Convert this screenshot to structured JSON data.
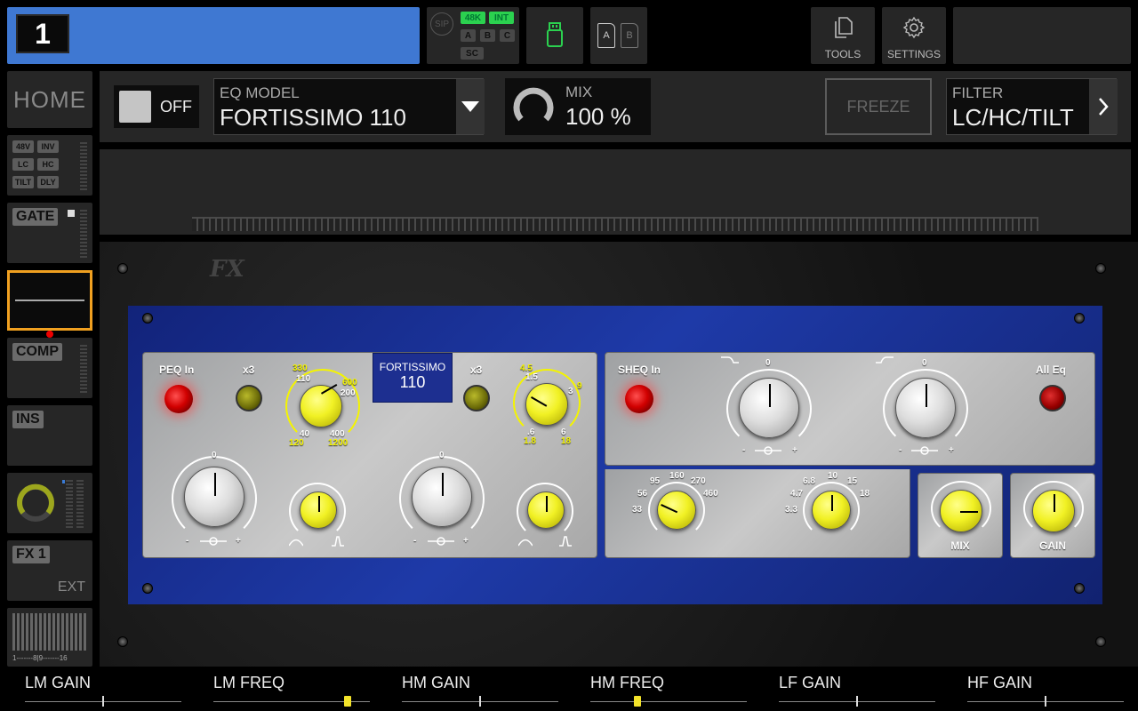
{
  "channel": {
    "number": "1"
  },
  "io": {
    "sip_label": "SIP",
    "rate": "48K",
    "clock": "INT",
    "inputs": [
      "A",
      "B",
      "C"
    ],
    "sc": "SC",
    "accent_on": "#2bd14f"
  },
  "snapshot_cards": [
    "A",
    "B"
  ],
  "toolbar": {
    "tools_label": "TOOLS",
    "settings_label": "SETTINGS"
  },
  "sidebar": {
    "home_label": "HOME",
    "input_tags": [
      "48V",
      "INV",
      "LC",
      "HC",
      "TILT",
      "DLY"
    ],
    "gate_label": "GATE",
    "comp_label": "COMP",
    "ins_label": "INS",
    "fx_label": "FX 1",
    "fx_ext": "EXT",
    "meter_scale": "1-------8|9-------16",
    "selected_color": "#f0a020"
  },
  "header": {
    "power_label": "OFF",
    "eq_model_label": "EQ MODEL",
    "eq_model_value": "FORTISSIMO 110",
    "mix_label": "MIX",
    "mix_value": "100 %",
    "freeze_label": "FREEZE",
    "filter_label": "FILTER",
    "filter_value": "LC/HC/TILT"
  },
  "plugin": {
    "brand_logo": "FX",
    "peq_in": "PEQ In",
    "x3_left": "x3",
    "x3_right": "x3",
    "name_line1": "FORTISSIMO",
    "name_line2": "110",
    "lm_freq_scale": [
      "330",
      "110",
      "600",
      "200",
      "40",
      "400",
      "120",
      "1200"
    ],
    "hm_freq_scale": [
      "4.5",
      "1.5",
      "3",
      "9",
      ".6",
      "6",
      "1.8",
      "18"
    ],
    "zero": "0",
    "minus": "-",
    "plus": "+",
    "sheq_in": "SHEQ In",
    "all_eq": "All Eq",
    "lf_freq_scale": [
      "95",
      "160",
      "270",
      "56",
      "460",
      "33"
    ],
    "hf_freq_scale": [
      "6.8",
      "10",
      "15",
      "4.7",
      "18",
      "3.3"
    ],
    "mix_knob_label": "MIX",
    "gain_knob_label": "GAIN"
  },
  "bottom_params": [
    {
      "label": "LM GAIN",
      "value": 0.5,
      "thumb": false
    },
    {
      "label": "LM FREQ",
      "value": 0.86,
      "thumb": true
    },
    {
      "label": "HM GAIN",
      "value": 0.5,
      "thumb": false
    },
    {
      "label": "HM FREQ",
      "value": 0.3,
      "thumb": true
    },
    {
      "label": "LF GAIN",
      "value": 0.5,
      "thumb": false
    },
    {
      "label": "HF GAIN",
      "value": 0.5,
      "thumb": false
    }
  ]
}
